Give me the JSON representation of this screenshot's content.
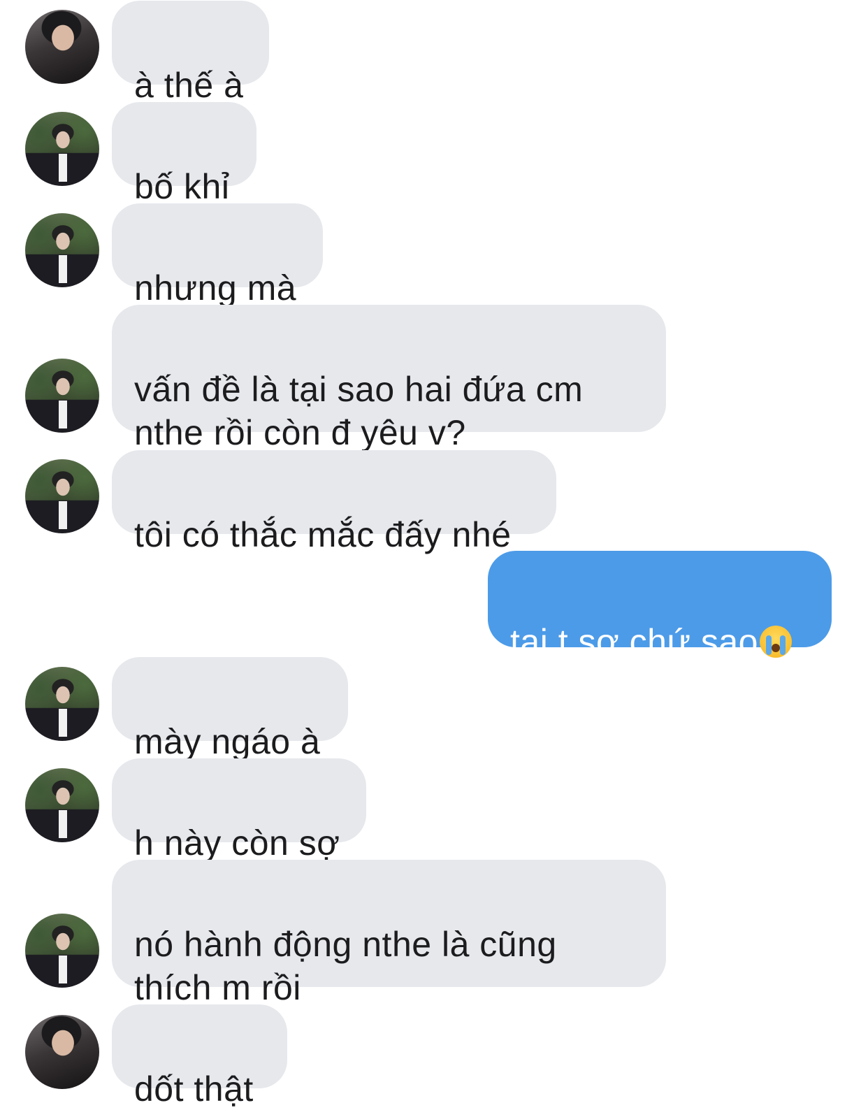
{
  "messages": [
    {
      "direction": "in",
      "avatar": "avatar-photo-dark-jacket",
      "text": "à thế à"
    },
    {
      "direction": "in",
      "avatar": "avatar-photo-suit",
      "text": "bố khỉ"
    },
    {
      "direction": "in",
      "avatar": "avatar-photo-suit",
      "text": "nhưng mà"
    },
    {
      "direction": "in",
      "avatar": "avatar-photo-suit",
      "text": "vấn đề là tại sao hai đứa cm\nnthe rồi còn đ yêu v?"
    },
    {
      "direction": "in",
      "avatar": "avatar-photo-suit",
      "text": "tôi có thắc mắc đấy nhé"
    },
    {
      "direction": "out",
      "text": "tại t sợ chứ sao",
      "emoji": "loudly-crying-face"
    },
    {
      "direction": "in",
      "avatar": "avatar-photo-suit",
      "text": "mày ngáo à"
    },
    {
      "direction": "in",
      "avatar": "avatar-photo-suit",
      "text": "h này còn sợ"
    },
    {
      "direction": "in",
      "avatar": "avatar-photo-suit",
      "text": "nó hành động nthe là cũng\nthích m rồi"
    },
    {
      "direction": "in",
      "avatar": "avatar-photo-dark-jacket",
      "text": "dốt thật"
    }
  ],
  "colors": {
    "incoming_bubble": "#e6e8ec",
    "outgoing_bubble": "#4c9be8",
    "incoming_text": "#1c1c1e",
    "outgoing_text": "#ffffff"
  }
}
